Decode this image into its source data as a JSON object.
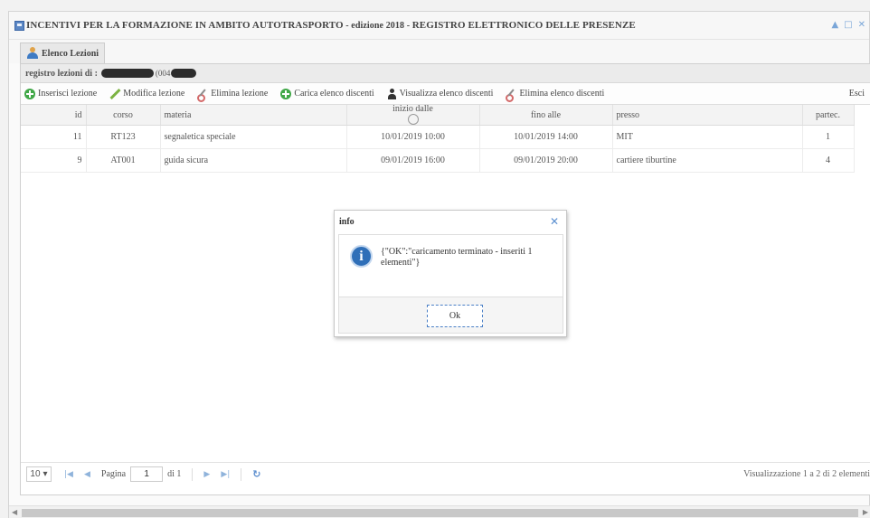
{
  "window": {
    "title_main": "INCENTIVI PER LA FORMAZIONE IN AMBITO AUTOTRASPORTO",
    "title_edition": " - edizione 2018 - ",
    "title_tail": "REGISTRO ELETTRONICO DELLE PRESENZE",
    "controls": [
      "▲",
      "□",
      "✕"
    ]
  },
  "tab": {
    "label": "Elenco Lezioni"
  },
  "registro": {
    "label": "registro lezioni di :",
    "code": "(004"
  },
  "toolbar": {
    "inserisci": "Inserisci lezione",
    "modifica": "Modifica lezione",
    "elimina": "Elimina lezione",
    "carica": "Carica elenco discenti",
    "visualizza": "Visualizza elenco discenti",
    "elimina_elenco": "Elimina elenco discenti",
    "esci": "Esci"
  },
  "grid": {
    "headers": {
      "id": "id",
      "corso": "corso",
      "materia": "materia",
      "inizio": "inizio dalle",
      "fine": "fino alle",
      "presso": "presso",
      "partec": "partec."
    },
    "rows": [
      {
        "id": "11",
        "corso": "RT123",
        "materia": "segnaletica speciale",
        "inizio": "10/01/2019 10:00",
        "fine": "10/01/2019 14:00",
        "presso": "MIT",
        "partec": "1"
      },
      {
        "id": "9",
        "corso": "AT001",
        "materia": "guida sicura",
        "inizio": "09/01/2019 16:00",
        "fine": "09/01/2019 20:00",
        "presso": "cartiere tiburtine",
        "partec": "4"
      }
    ]
  },
  "pager": {
    "page_size": "10",
    "page_label": "Pagina",
    "page_value": "1",
    "page_of": "di 1",
    "info": "Visualizzazione 1 a 2 di 2 elementi"
  },
  "dialog": {
    "title": "info",
    "message": "{\"OK\":\"caricamento terminato - inseriti 1 elementi\"}",
    "ok_label": "Ok"
  }
}
